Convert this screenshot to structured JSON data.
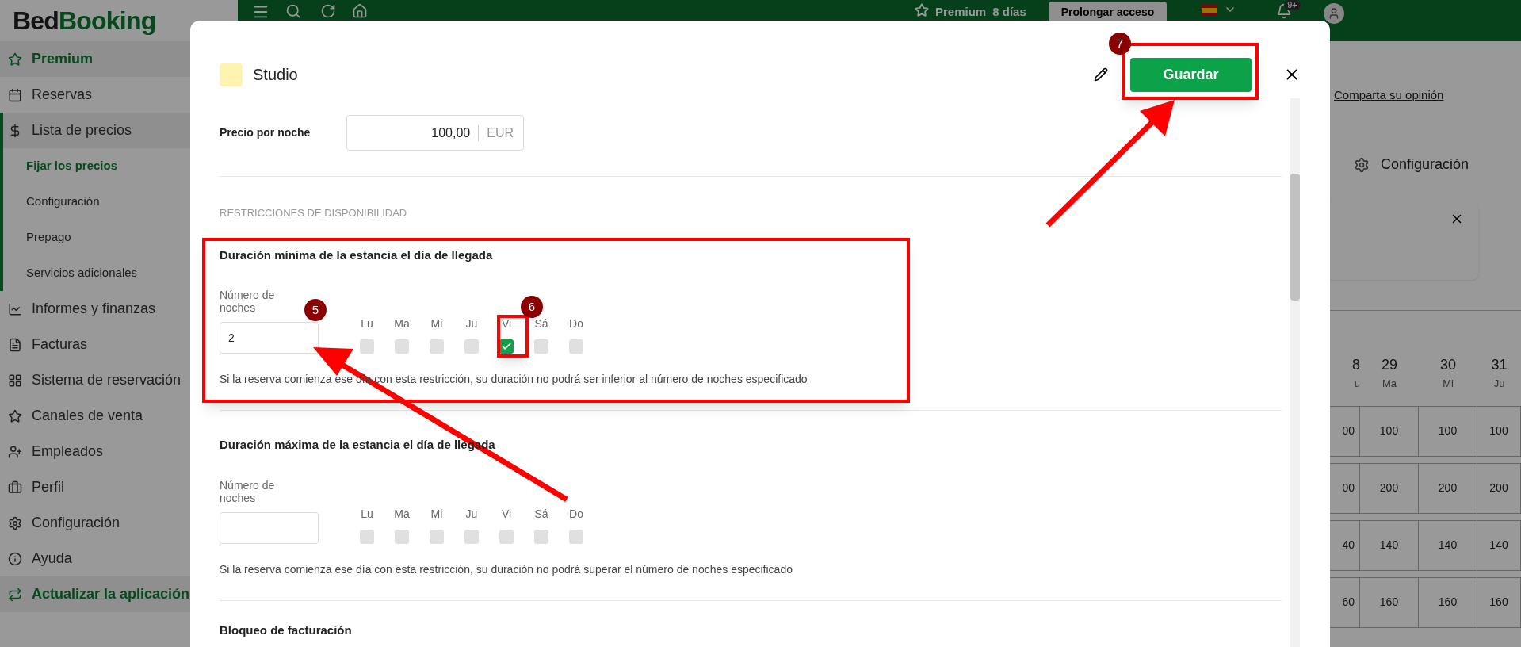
{
  "logo": {
    "part_1": "Bed",
    "part_2": "Booking"
  },
  "topbar": {
    "premium": "Premium",
    "days": "8 días",
    "extend_button": "Prolongar acceso",
    "notifications_badge": "9+"
  },
  "sidebar": {
    "items": [
      {
        "label": "Premium",
        "kind": "promo",
        "selected": false
      },
      {
        "label": "Reservas",
        "kind": "main",
        "selected": false
      },
      {
        "label": "Lista de precios",
        "kind": "main",
        "selected": false,
        "expanded": true,
        "children": [
          {
            "label": "Fijar los precios",
            "selected": true
          },
          {
            "label": "Configuración",
            "selected": false
          },
          {
            "label": "Prepago",
            "selected": false
          },
          {
            "label": "Servicios adicionales",
            "selected": false
          }
        ]
      },
      {
        "label": "Informes y finanzas",
        "kind": "main",
        "selected": false
      },
      {
        "label": "Facturas",
        "kind": "main",
        "selected": false
      },
      {
        "label": "Sistema de reservación",
        "kind": "main",
        "selected": false
      },
      {
        "label": "Canales de venta",
        "kind": "main",
        "selected": false
      },
      {
        "label": "Empleados",
        "kind": "main",
        "selected": false
      },
      {
        "label": "Perfil",
        "kind": "main",
        "selected": false
      },
      {
        "label": "Configuración",
        "kind": "main",
        "selected": false
      },
      {
        "label": "Ayuda",
        "kind": "main",
        "selected": false
      },
      {
        "label": "Actualizar la aplicación",
        "kind": "promo",
        "selected": false
      }
    ]
  },
  "background": {
    "feedback_link": "Comparta su opinión",
    "settings_link": "Configuración",
    "calendar": {
      "columns": [
        {
          "date": "8",
          "day": "u"
        },
        {
          "date": "29",
          "day": "Ma"
        },
        {
          "date": "30",
          "day": "Mi"
        },
        {
          "date": "31",
          "day": "Ju"
        }
      ],
      "rows": [
        [
          "00",
          "100",
          "100",
          "100"
        ],
        [
          "00",
          "200",
          "200",
          "200"
        ],
        [
          "40",
          "140",
          "140",
          "140"
        ],
        [
          "60",
          "160",
          "160",
          "160"
        ]
      ]
    }
  },
  "modal": {
    "title": "Studio",
    "save_button": "Guardar",
    "price": {
      "label": "Precio por noche",
      "value": "100,00",
      "currency": "EUR"
    },
    "section_heading": "RESTRICCIONES DE DISPONIBILIDAD",
    "restrictions": [
      {
        "title": "Duración mínima de la estancia el día de llegada",
        "field_label": "Número de noches",
        "value": "2",
        "hint": "Si la reserva comienza ese día con esta restricción, su duración no podrá ser inferior al número de noches especificado",
        "days": [
          {
            "label": "Lu",
            "checked": false
          },
          {
            "label": "Ma",
            "checked": false
          },
          {
            "label": "Mi",
            "checked": false
          },
          {
            "label": "Ju",
            "checked": false
          },
          {
            "label": "Vi",
            "checked": true
          },
          {
            "label": "Sá",
            "checked": false
          },
          {
            "label": "Do",
            "checked": false
          }
        ]
      },
      {
        "title": "Duración máxima de la estancia el día de llegada",
        "field_label": "Número de noches",
        "hint": "Si la reserva comienza ese día con esta restricción, su duración no podrá superar el número de noches especificado",
        "days": [
          {
            "label": "Lu",
            "checked": false
          },
          {
            "label": "Ma",
            "checked": false
          },
          {
            "label": "Mi",
            "checked": false
          },
          {
            "label": "Ju",
            "checked": false
          },
          {
            "label": "Vi",
            "checked": false
          },
          {
            "label": "Sá",
            "checked": false
          },
          {
            "label": "Do",
            "checked": false
          }
        ]
      }
    ],
    "next_section_title": "Bloqueo de facturación"
  },
  "annotations": [
    {
      "number": "5"
    },
    {
      "number": "6"
    },
    {
      "number": "7"
    }
  ]
}
